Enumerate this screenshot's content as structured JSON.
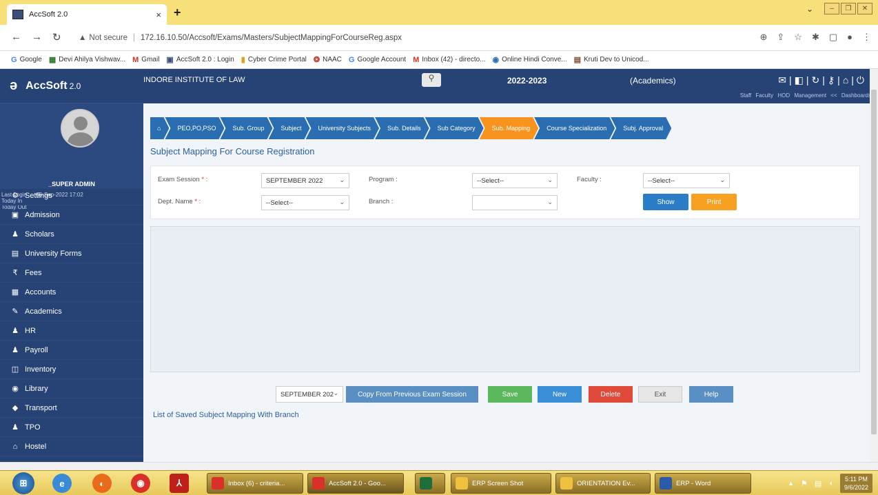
{
  "browser": {
    "tab_title": "AccSoft 2.0",
    "tab_close": "×",
    "new_tab": "+",
    "not_secure": "Not secure",
    "url": "172.16.10.50/Accsoft/Exams/Masters/SubjectMappingForCourseReg.aspx",
    "bookmarks": [
      "Google",
      "Devi Ahilya Vishwav...",
      "Gmail",
      "AccSoft 2.0 : Login",
      "Cyber Crime Portal",
      "NAAC",
      "Google Account",
      "Inbox (42) - directo...",
      "Online Hindi Conve...",
      "Kruti Dev to Unicod..."
    ]
  },
  "app": {
    "logo": "AccSoft",
    "version": "2.0",
    "institute": "INDORE INSTITUTE OF LAW",
    "session_year": "2022-2023",
    "module": "(Academics)",
    "top_links": "Staff  Faculty  HOD  Management << Dashboards"
  },
  "profile": {
    "username": "_SUPER ADMIN",
    "last_login_label": "Last Login",
    "last_login_value": "06-Sep-2022 17:02",
    "today_in": "Today In",
    "today_out": "Today Out"
  },
  "menu": [
    "Settings",
    "Admission",
    "Scholars",
    "University Forms",
    "Fees",
    "Accounts",
    "Academics",
    "HR",
    "Payroll",
    "Inventory",
    "Library",
    "Transport",
    "TPO",
    "Hostel"
  ],
  "crumbs": [
    "PEO,PO,PSO",
    "Sub. Group",
    "Subject",
    "University Subjects",
    "Sub. Details",
    "Sub Category",
    "Sub. Mapping",
    "Course Specialization",
    "Subj. Approval"
  ],
  "page_title": "Subject Mapping For Course Registration",
  "filters": {
    "exam_session_label": "Exam Session",
    "exam_session_value": "SEPTEMBER 2022",
    "program_label": "Program :",
    "program_value": "--Select--",
    "faculty_label": "Faculty :",
    "faculty_value": "--Select--",
    "dept_label": "Dept. Name",
    "dept_value": "--Select--",
    "branch_label": "Branch :",
    "branch_value": "",
    "show": "Show",
    "print": "Print",
    "required_mark": "* :"
  },
  "actions": {
    "session_value": "SEPTEMBER 202",
    "copy": "Copy From Previous Exam Session",
    "save": "Save",
    "new": "New",
    "delete": "Delete",
    "exit": "Exit",
    "help": "Help"
  },
  "saved_list_title": "List of Saved Subject Mapping With Branch",
  "taskbar": {
    "tasks": [
      "Inbox (6) - criteria...",
      "AccSoft 2.0 - Goo...",
      "",
      "ERP Screen Shot",
      "ORIENTATION Ev...",
      "ERP - Word"
    ],
    "time": "5:11 PM",
    "date": "9/6/2022"
  },
  "colors": {
    "sidebar": "#274275",
    "crumb": "#2a6db0",
    "crumb_active": "#f7931e",
    "show_btn": "#2a7cc7",
    "print_btn": "#f7a021",
    "save_btn": "#5cb85c",
    "new_btn": "#3a8ed8",
    "delete_btn": "#e04a3a"
  }
}
